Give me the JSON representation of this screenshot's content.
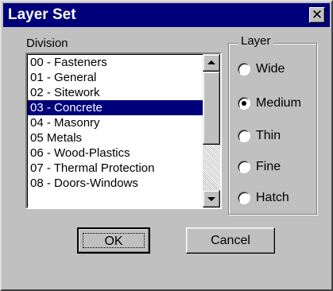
{
  "window": {
    "title": "Layer Set",
    "close_icon": "close-icon",
    "close_glyph": "✕"
  },
  "division": {
    "label": "Division",
    "items": [
      {
        "label": "00 - Fasteners",
        "selected": false
      },
      {
        "label": "01 - General",
        "selected": false
      },
      {
        "label": "02 - Sitework",
        "selected": false
      },
      {
        "label": "03 - Concrete",
        "selected": true
      },
      {
        "label": "04 - Masonry",
        "selected": false
      },
      {
        "label": "05   Metals",
        "selected": false
      },
      {
        "label": "06 - Wood-Plastics",
        "selected": false
      },
      {
        "label": "07 - Thermal Protection",
        "selected": false
      },
      {
        "label": "08 - Doors-Windows",
        "selected": false
      }
    ]
  },
  "layer": {
    "legend": "Layer",
    "options": [
      {
        "label": "Wide",
        "checked": false
      },
      {
        "label": "Medium",
        "checked": true
      },
      {
        "label": "Thin",
        "checked": false
      },
      {
        "label": "Fine",
        "checked": false
      },
      {
        "label": "Hatch",
        "checked": false
      }
    ]
  },
  "buttons": {
    "ok_label": "OK",
    "cancel_label": "Cancel"
  },
  "colors": {
    "titlebar": "#00007b",
    "selection": "#00007b",
    "face": "#c0c0c0"
  }
}
